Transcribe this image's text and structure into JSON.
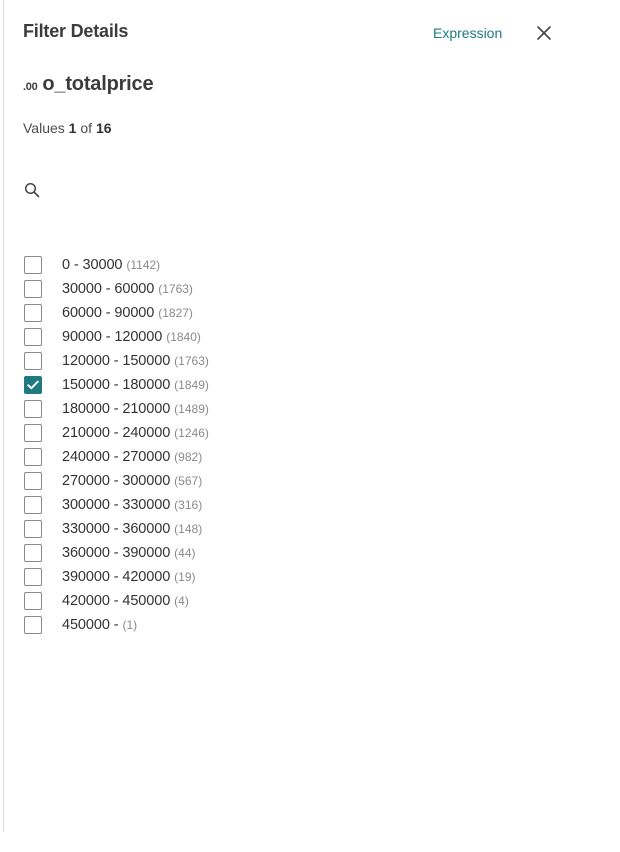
{
  "header": {
    "title": "Filter Details",
    "expression_label": "Expression",
    "close_icon": "close-icon"
  },
  "field": {
    "type_indicator": ".00",
    "name": "o_totalprice"
  },
  "values_summary": {
    "prefix": "Values",
    "current": "1",
    "separator": "of",
    "total": "16"
  },
  "search": {
    "icon": "search-icon",
    "value": "",
    "placeholder": ""
  },
  "colors": {
    "accent": "#1f7a80",
    "text": "#333333",
    "muted": "#8a8a8a"
  },
  "items": [
    {
      "label": "0 - 30000",
      "count": "(1142)",
      "checked": false
    },
    {
      "label": "30000 - 60000",
      "count": "(1763)",
      "checked": false
    },
    {
      "label": "60000 - 90000",
      "count": "(1827)",
      "checked": false
    },
    {
      "label": "90000 - 120000",
      "count": "(1840)",
      "checked": false
    },
    {
      "label": "120000 - 150000",
      "count": "(1763)",
      "checked": false
    },
    {
      "label": "150000 - 180000",
      "count": "(1849)",
      "checked": true
    },
    {
      "label": "180000 - 210000",
      "count": "(1489)",
      "checked": false
    },
    {
      "label": "210000 - 240000",
      "count": "(1246)",
      "checked": false
    },
    {
      "label": "240000 - 270000",
      "count": "(982)",
      "checked": false
    },
    {
      "label": "270000 - 300000",
      "count": "(567)",
      "checked": false
    },
    {
      "label": "300000 - 330000",
      "count": "(316)",
      "checked": false
    },
    {
      "label": "330000 - 360000",
      "count": "(148)",
      "checked": false
    },
    {
      "label": "360000 - 390000",
      "count": "(44)",
      "checked": false
    },
    {
      "label": "390000 - 420000",
      "count": "(19)",
      "checked": false
    },
    {
      "label": "420000 - 450000",
      "count": "(4)",
      "checked": false
    },
    {
      "label": "450000 -",
      "count": "(1)",
      "checked": false
    }
  ]
}
